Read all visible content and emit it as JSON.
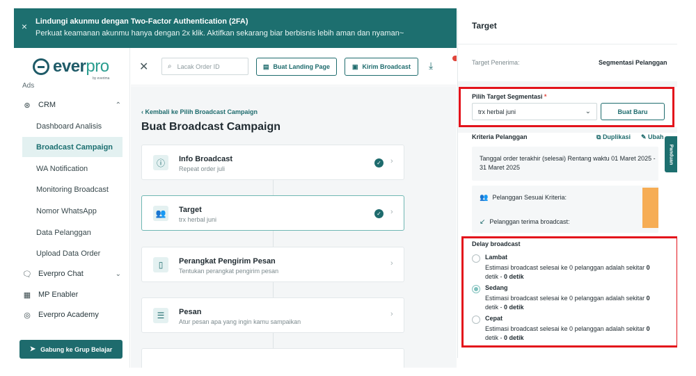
{
  "banner": {
    "title": "Lindungi akunmu dengan Two-Factor Authentication (2FA)",
    "subtitle": "Perkuat keamanan akunmu hanya dengan 2x klik. Aktifkan sekarang biar berbisnis lebih aman dan nyaman~",
    "close_icon": "×"
  },
  "logo": {
    "word_a": "ever",
    "word_b": "pro",
    "by": "by everima"
  },
  "sidebar": {
    "cut_label": "Ads",
    "crm": {
      "label": "CRM",
      "icon": "⊛",
      "chevron": "⌃"
    },
    "items": [
      {
        "label": "Dashboard Analisis"
      },
      {
        "label": "Broadcast Campaign"
      },
      {
        "label": "WA Notification"
      },
      {
        "label": "Monitoring Broadcast"
      },
      {
        "label": "Nomor WhatsApp"
      },
      {
        "label": "Data Pelanggan"
      },
      {
        "label": "Upload Data Order"
      }
    ],
    "groups": [
      {
        "label": "Everpro Chat",
        "icon": "🗨",
        "chevron": "⌄"
      },
      {
        "label": "MP Enabler",
        "icon": "▦",
        "chevron": ""
      },
      {
        "label": "Everpro Academy",
        "icon": "◎",
        "chevron": ""
      }
    ],
    "join_button": "Gabung ke Grup Belajar"
  },
  "toolbar": {
    "search_placeholder": "Lacak Order ID",
    "landing_button": "Buat Landing Page",
    "broadcast_button": "Kirim Broadcast"
  },
  "main": {
    "back_link": "‹ Kembali ke Pilih Broadcast Campaign",
    "title": "Buat Broadcast Campaign",
    "steps": [
      {
        "title": "Info Broadcast",
        "sub": "Repeat order juli",
        "icon": "ⓘ",
        "done": true
      },
      {
        "title": "Target",
        "sub": "trx herbal juni",
        "icon": "👥",
        "done": true
      },
      {
        "title": "Perangkat Pengirim Pesan",
        "sub": "Tentukan perangkat pengirim pesan",
        "icon": "▯",
        "done": false
      },
      {
        "title": "Pesan",
        "sub": "Atur pesan apa yang ingin kamu sampaikan",
        "icon": "☰",
        "done": false
      }
    ]
  },
  "panel": {
    "title": "Target",
    "recipient_label": "Target Penerima:",
    "recipient_value": "Segmentasi Pelanggan",
    "segment_label": "Pilih Target Segmentasi",
    "segment_required": "*",
    "segment_value": "trx herbal juni",
    "new_button": "Buat Baru",
    "criteria_title": "Kriteria Pelanggan",
    "duplicate_label": "Duplikasi",
    "edit_label": "Ubah",
    "criteria_line1": "Tanggal order terakhir (selesai) Rentang waktu 01 Maret 2025 -",
    "criteria_line2": "31 Maret 2025",
    "match_label": "Pelanggan Sesuai Kriteria:",
    "receive_label": "Pelanggan terima broadcast:",
    "delay_title": "Delay broadcast",
    "options": [
      {
        "label": "Lambat",
        "desc": "Estimasi broadcast selesai ke 0 pelanggan adalah sekitar",
        "bold1": "0",
        "mid": "detik -",
        "bold2": "0 detik",
        "selected": false
      },
      {
        "label": "Sedang",
        "desc": "Estimasi broadcast selesai ke 0 pelanggan adalah sekitar",
        "bold1": "0",
        "mid": "detik -",
        "bold2": "0 detik",
        "selected": true
      },
      {
        "label": "Cepat",
        "desc": "Estimasi broadcast selesai ke 0 pelanggan adalah sekitar",
        "bold1": "0",
        "mid": "detik -",
        "bold2": "0 detik",
        "selected": false
      }
    ],
    "guide_tab": "Panduan"
  },
  "colors": {
    "brand": "#1e6b6d",
    "banner": "#1d6f6f",
    "highlight": "#e3131b",
    "accent_bar": "#f6ad55"
  }
}
